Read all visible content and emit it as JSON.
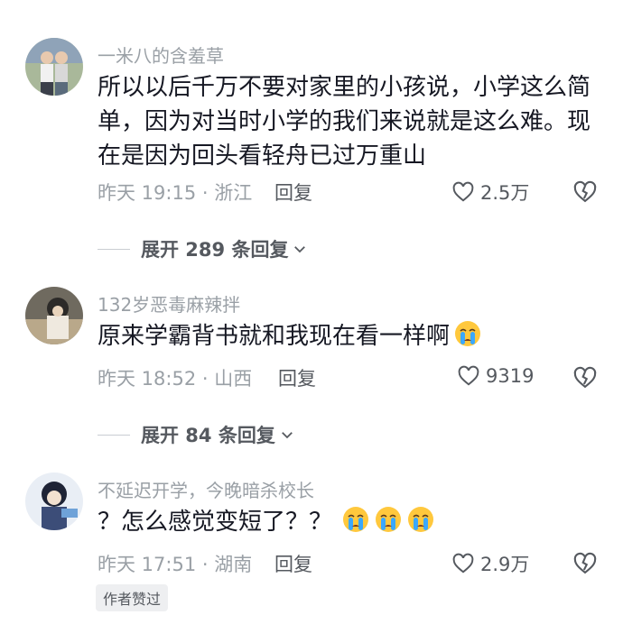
{
  "comments": [
    {
      "username": "一米八的含羞草",
      "text": "所以以后千万不要对家里的小孩说，小学这么简单，因为对当时小学的我们来说就是这么难。现在是因为回头看轻舟已过万重山",
      "meta": "昨天 19:15 · 浙江",
      "reply": "回复",
      "likes": "2.5万",
      "expand": "展开 289 条回复",
      "avatar_icon": "avatar-two-girls"
    },
    {
      "username": "132岁恶毒麻辣拌",
      "text": "原来学霸背书就和我现在看一样啊",
      "emoji": "crying-face",
      "meta": "昨天 18:52 · 山西",
      "reply": "回复",
      "likes": "9319",
      "expand": "展开 84 条回复",
      "avatar_icon": "avatar-dark-anime"
    },
    {
      "username": "不延迟开学，今晚暗杀校长",
      "text": "？怎么感觉变短了？？",
      "emoji": "crying-face",
      "emoji_count": 3,
      "meta": "昨天 17:51 · 湖南",
      "reply": "回复",
      "likes": "2.9万",
      "badge": "作者赞过",
      "avatar_icon": "avatar-anime-character"
    }
  ],
  "colors": {
    "text": "#161823",
    "secondary": "#9aa0a6",
    "action": "#55595f",
    "emoji_face": "#ffc83d",
    "emoji_tear": "#3aa8ff"
  }
}
